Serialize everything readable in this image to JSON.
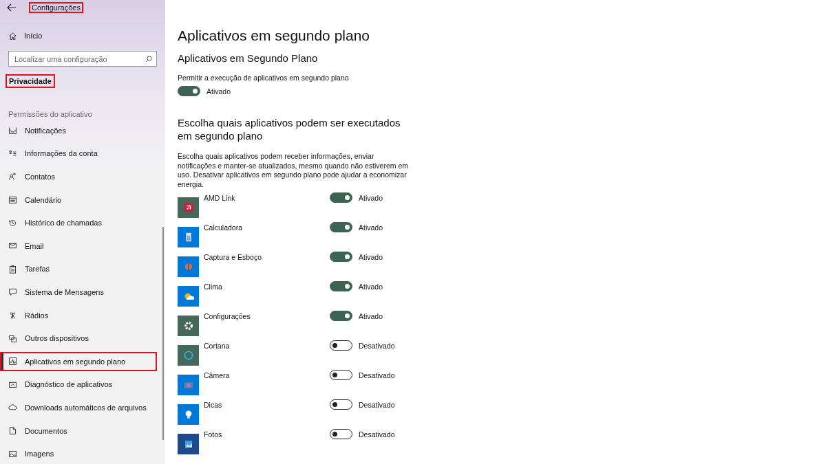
{
  "window": {
    "title": "Configurações",
    "title_highlighted": true
  },
  "sidebar": {
    "home": "Início",
    "search": {
      "placeholder": "Localizar uma configuração"
    },
    "category": "Privacidade",
    "category_highlighted": true,
    "section": "Permissões do aplicativo",
    "items": [
      {
        "label": "Notificações",
        "selected": false,
        "highlighted": false
      },
      {
        "label": "Informações da conta",
        "selected": false,
        "highlighted": false
      },
      {
        "label": "Contatos",
        "selected": false,
        "highlighted": false
      },
      {
        "label": "Calendário",
        "selected": false,
        "highlighted": false
      },
      {
        "label": "Histórico de chamadas",
        "selected": false,
        "highlighted": false
      },
      {
        "label": "Email",
        "selected": false,
        "highlighted": false
      },
      {
        "label": "Tarefas",
        "selected": false,
        "highlighted": false
      },
      {
        "label": "Sistema de Mensagens",
        "selected": false,
        "highlighted": false
      },
      {
        "label": "Rádios",
        "selected": false,
        "highlighted": false
      },
      {
        "label": "Outros dispositivos",
        "selected": false,
        "highlighted": false
      },
      {
        "label": "Aplicativos em segundo plano",
        "selected": true,
        "highlighted": true
      },
      {
        "label": "Diagnóstico de aplicativos",
        "selected": false,
        "highlighted": false
      },
      {
        "label": "Downloads automáticos de arquivos",
        "selected": false,
        "highlighted": false
      },
      {
        "label": "Documentos",
        "selected": false,
        "highlighted": false
      },
      {
        "label": "Imagens",
        "selected": false,
        "highlighted": false
      }
    ]
  },
  "main": {
    "title": "Aplicativos em segundo plano",
    "section_title": "Aplicativos em Segundo Plano",
    "master_label": "Permitir a execução de aplicativos em segundo plano",
    "master_toggle": {
      "on": true,
      "state_text": "Ativado"
    },
    "apps_title": "Escolha quais aplicativos podem ser executados em segundo plano",
    "apps_description": "Escolha quais aplicativos podem receber informações, enviar notificações e manter-se atualizados, mesmo quando não estiverem em uso. Desativar aplicativos em segundo plano pode ajudar a economizar energia.",
    "apps": [
      {
        "name": "AMD Link",
        "color": "#46685a",
        "on": true,
        "state_text": "Ativado"
      },
      {
        "name": "Calculadora",
        "color": "#0078d7",
        "on": true,
        "state_text": "Ativado"
      },
      {
        "name": "Captura e Esboço",
        "color": "#0078d7",
        "on": true,
        "state_text": "Ativado"
      },
      {
        "name": "Clima",
        "color": "#0078d7",
        "on": true,
        "state_text": "Ativado"
      },
      {
        "name": "Configurações",
        "color": "#46685a",
        "on": true,
        "state_text": "Ativado"
      },
      {
        "name": "Cortana",
        "color": "#46685a",
        "on": false,
        "state_text": "Desativado"
      },
      {
        "name": "Câmera",
        "color": "#0078d7",
        "on": false,
        "state_text": "Desativado"
      },
      {
        "name": "Dicas",
        "color": "#0078d7",
        "on": false,
        "state_text": "Desativado"
      },
      {
        "name": "Fotos",
        "color": "#1e4a8c",
        "on": false,
        "state_text": "Desativado"
      }
    ]
  }
}
